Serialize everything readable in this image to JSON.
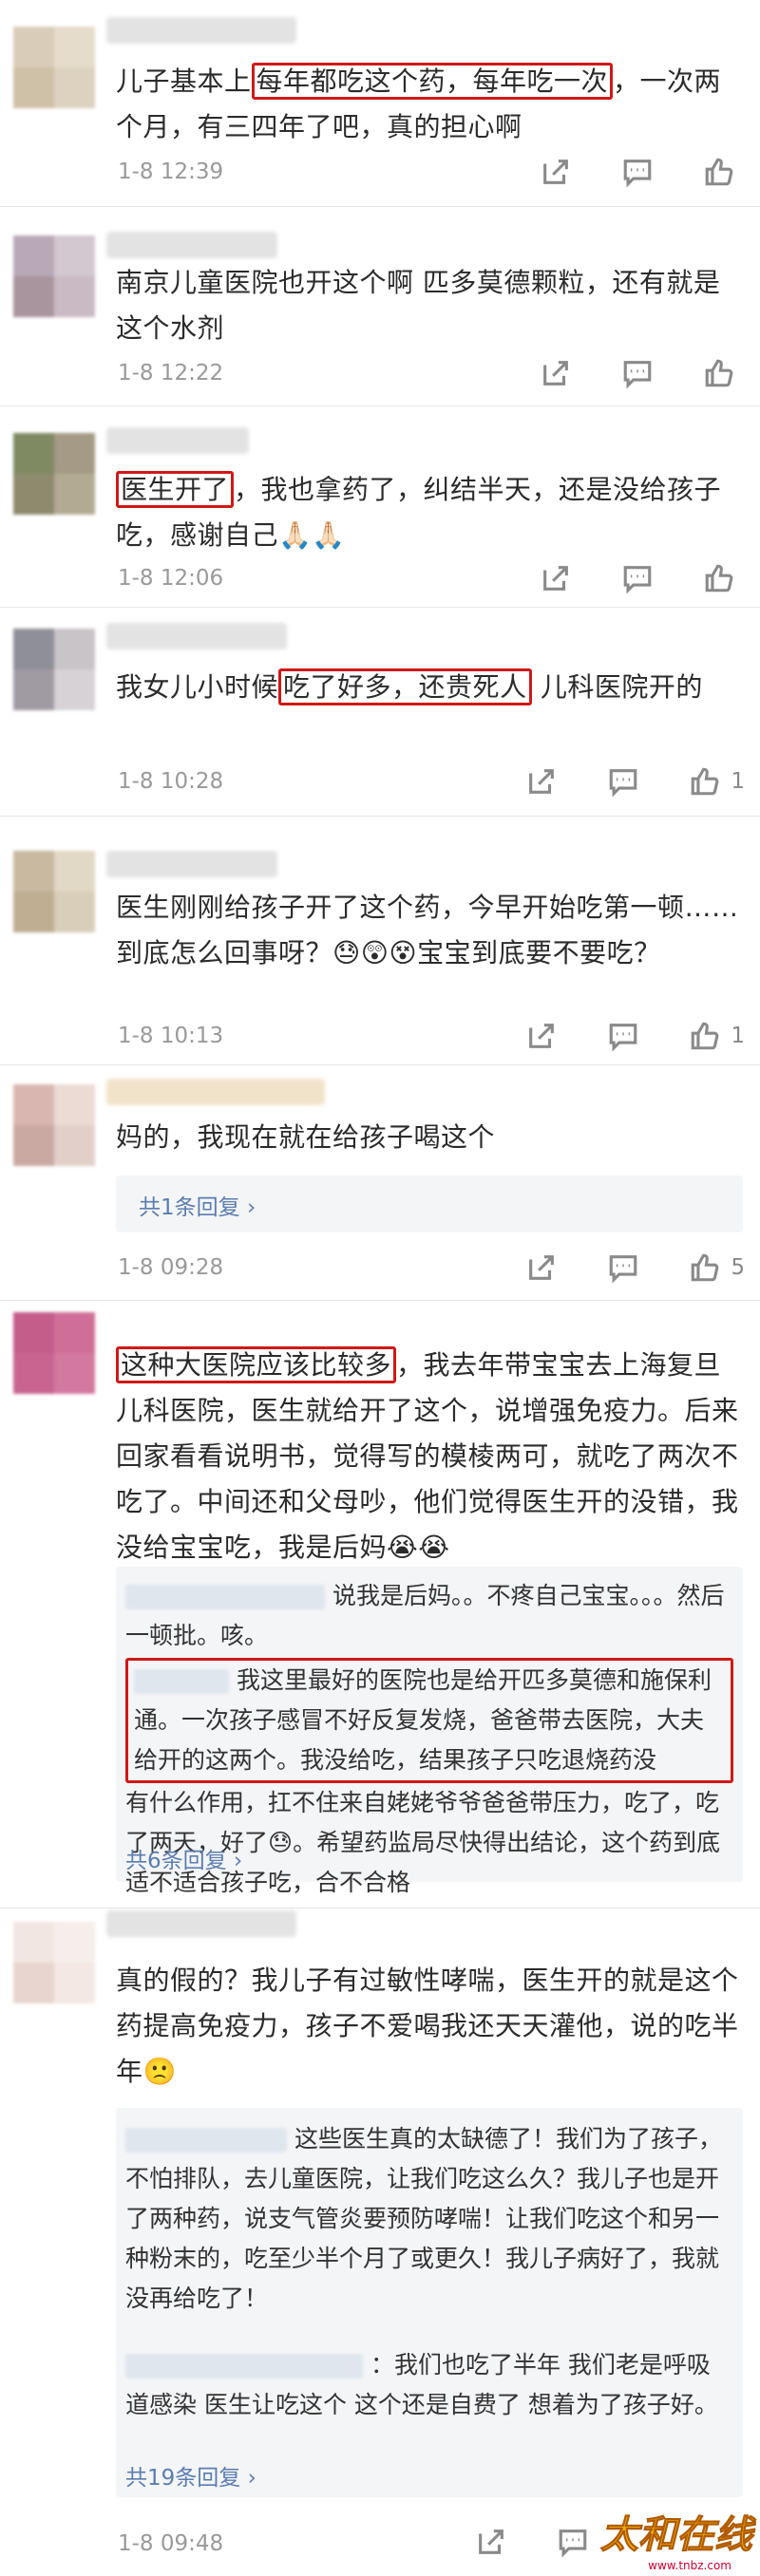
{
  "icons": {
    "edit": "share-icon",
    "comment": "comment-icon",
    "like": "thumb-up-icon",
    "reply_chevron": "chevron-right-icon"
  },
  "comments": [
    {
      "text": [
        "儿子基本上",
        "每年都吃这个药，每年吃一次",
        "，一次两个月，有三四年了吧，真的担心啊"
      ],
      "time": "1-8 12:39",
      "likes": ""
    },
    {
      "text": [
        "南京儿童医院也开这个啊 匹多莫德颗粒，还有就是这个水剂"
      ],
      "time": "1-8 12:22",
      "likes": ""
    },
    {
      "text": [
        "医生开了",
        "，我也拿药了，纠结半天，还是没给孩子吃，感谢自己🙏🏻🙏🏻"
      ],
      "time": "1-8 12:06",
      "likes": ""
    },
    {
      "text": [
        "我女儿小时候",
        "吃了好多，还贵死人",
        " 儿科医院开的"
      ],
      "time": "1-8 10:28",
      "likes": "1"
    },
    {
      "text": [
        "医生刚刚给孩子开了这个药，今早开始吃第一顿……到底怎么回事呀？😓😲😵宝宝到底要不要吃？"
      ],
      "time": "1-8 10:13",
      "likes": "1"
    },
    {
      "text": [
        "妈的，我现在就在给孩子喝这个"
      ],
      "time": "1-8 09:28",
      "likes": "5",
      "reply_link": "共1条回复"
    },
    {
      "text": [
        "这种大医院应该比较多",
        "，我去年带宝宝去上海复旦儿科医院，医生就给开了这个，说增强免疫力。后来回家看看说明书，觉得写的模棱两可，就吃了两次不吃了。中间还和父母吵，他们觉得医生开的没错，我没给宝宝吃，我是后妈😭😭"
      ],
      "replies": [
        {
          "text": "说我是后妈。。不疼自己宝宝。。。然后一顿批。咳。"
        },
        {
          "text_hl": "我这里最好的医院也是给开匹多莫德和施保利通。一次孩子感冒不好反复发烧，爸爸带去医院，大夫给开的这两个。我没给吃，结果孩子只吃退烧药没",
          "text": "有什么作用，扛不住来自姥姥爷爷爸爸带压力，吃了，吃了两天，好了😓。希望药监局尽快得出结论，这个药到底适不适合孩子吃，合不合格"
        }
      ],
      "reply_link": "共6条回复"
    },
    {
      "text": [
        "真的假的？我儿子有过敏性哮喘，医生开的就是这个药提高免疫力，孩子不爱喝我还天天灌他，说的吃半年🙁"
      ],
      "replies": [
        {
          "text": "这些医生真的太缺德了！我们为了孩子，不怕排队，去儿童医院，让我们吃这么久？我儿子也是开了两种药，说支气管炎要预防哮喘！让我们吃这个和另一种粉末的，吃至少半个月了或更久！我儿子病好了，我就没再给吃了！"
        },
        {
          "text": "：我们也吃了半年 我们老是呼吸道感染 医生让吃这个 这个还是自费了 想着为了孩子好。"
        }
      ],
      "reply_link": "共19条回复",
      "time": "1-8 09:48",
      "likes": ""
    }
  ],
  "watermark": {
    "brand": "太和在线",
    "url": "www.tnbz.com"
  }
}
